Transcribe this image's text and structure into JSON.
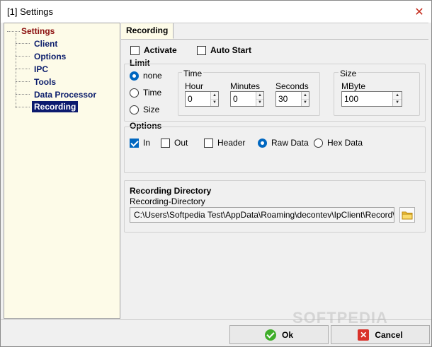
{
  "window": {
    "title": "[1] Settings",
    "close_glyph": "✕"
  },
  "tree": {
    "root": "Settings",
    "items": [
      {
        "label": "Client"
      },
      {
        "label": "Options"
      },
      {
        "label": "IPC"
      },
      {
        "label": "Tools"
      },
      {
        "label": "Data Processor"
      },
      {
        "label": "Recording",
        "selected": true
      }
    ]
  },
  "tab": {
    "label": "Recording"
  },
  "top_options": {
    "activate": "Activate",
    "auto_start": "Auto Start"
  },
  "limit": {
    "title": "Limit",
    "radios": {
      "none": "none",
      "time": "Time",
      "size": "Size",
      "selected": "none"
    },
    "time_group": {
      "title": "Time",
      "hour_label": "Hour",
      "hour_value": "0",
      "minutes_label": "Minutes",
      "minutes_value": "0",
      "seconds_label": "Seconds",
      "seconds_value": "30"
    },
    "size_group": {
      "title": "Size",
      "mbyte_label": "MByte",
      "mbyte_value": "100"
    }
  },
  "options": {
    "title": "Options",
    "in": "In",
    "out": "Out",
    "header": "Header",
    "raw_data": "Raw Data",
    "hex_data": "Hex Data",
    "checked": [
      "In"
    ],
    "data_format": "Raw Data"
  },
  "recording_directory": {
    "title": "Recording Directory",
    "label": "Recording-Directory",
    "path": "C:\\Users\\Softpedia Test\\AppData\\Roaming\\decontev\\IpClient\\Record\\"
  },
  "buttons": {
    "ok": "Ok",
    "cancel": "Cancel"
  },
  "icons": {
    "ok": "check-circle-icon",
    "cancel": "x-square-icon",
    "browse": "folder-icon"
  },
  "colors": {
    "tree_bg": "#fdfbe8",
    "selected_bg": "#0c1a6e",
    "accent": "#0067c0"
  },
  "watermark": "SOFTPEDIA"
}
